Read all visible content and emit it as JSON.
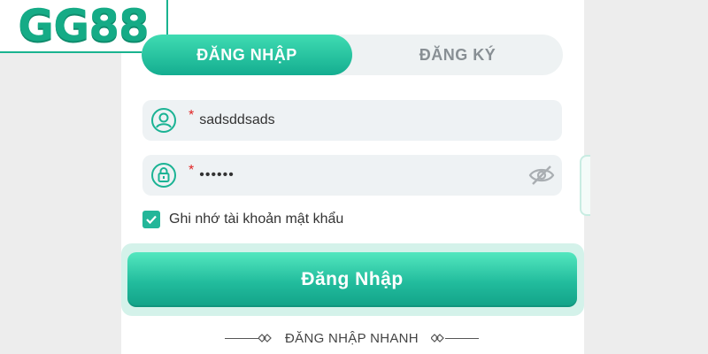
{
  "brand": {
    "logo_text": "GG88"
  },
  "tabs": [
    {
      "label": "ĐĂNG NHẬP",
      "active": true
    },
    {
      "label": "ĐĂNG KÝ",
      "active": false
    }
  ],
  "form": {
    "username": {
      "required_mark": "*",
      "value": "sadsddsads",
      "icon": "user-icon"
    },
    "password": {
      "required_mark": "*",
      "value": "••••••",
      "icon": "lock-icon",
      "toggle_icon": "eye-slash-icon"
    },
    "remember": {
      "label": "Ghi nhớ tài khoản mật khẩu",
      "checked": true
    },
    "submit_label": "Đăng Nhập"
  },
  "quick_login": {
    "label": "ĐĂNG NHẬP NHANH"
  },
  "colors": {
    "accent": "#1bb394",
    "accent_light": "#3fdcb2",
    "required": "#e02424"
  }
}
